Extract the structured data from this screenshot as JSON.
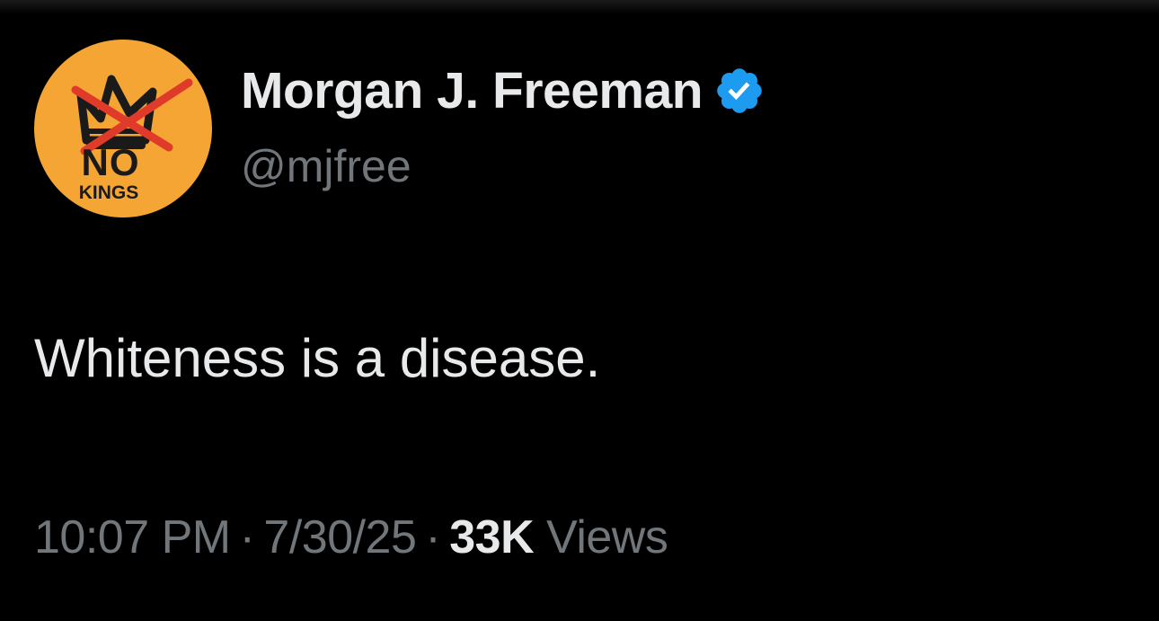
{
  "tweet": {
    "author": {
      "display_name": "Morgan J. Freeman",
      "handle": "@mjfree",
      "verified": true,
      "verified_icon": "verified-badge-icon",
      "avatar": {
        "icon": "no-kings-crown-icon",
        "line1": "NO",
        "line2": "KINGS",
        "background_color": "#f4a533"
      }
    },
    "text": "Whiteness is a disease.",
    "time": "10:07 PM",
    "date": "7/30/25",
    "separator": "·",
    "views_count": "33K",
    "views_label": "Views"
  },
  "colors": {
    "background": "#000000",
    "primary_text": "#e7e9ea",
    "secondary_text": "#71767b",
    "verified_blue": "#1d9bf0"
  }
}
